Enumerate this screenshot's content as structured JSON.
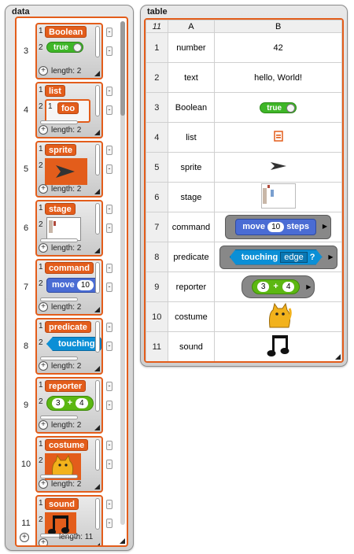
{
  "data_watcher": {
    "label": "data",
    "length_label": "length: 11",
    "items": [
      {
        "index": "3",
        "kind": "Boolean",
        "title": "Boolean",
        "value": "true",
        "length": "length: 2"
      },
      {
        "index": "4",
        "kind": "list",
        "title": "list",
        "value": "foo",
        "length": "length: 2"
      },
      {
        "index": "5",
        "kind": "sprite",
        "title": "sprite",
        "length": "length: 2"
      },
      {
        "index": "6",
        "kind": "stage",
        "title": "stage",
        "length": "length: 2"
      },
      {
        "index": "7",
        "kind": "command",
        "title": "command",
        "value": "move",
        "value2": "10",
        "length": "length: 2"
      },
      {
        "index": "8",
        "kind": "predicate",
        "title": "predicate",
        "value": "touching",
        "length": "length: 2"
      },
      {
        "index": "9",
        "kind": "reporter",
        "title": "reporter",
        "value": "3",
        "value2": "+",
        "value3": "4",
        "length": "length: 2"
      },
      {
        "index": "10",
        "kind": "costume",
        "title": "costume",
        "length": "length: 2"
      },
      {
        "index": "11",
        "kind": "sound",
        "title": "sound",
        "length": ""
      }
    ]
  },
  "table_watcher": {
    "label": "table",
    "corner": "11",
    "col_a": "A",
    "col_b": "B",
    "rows": [
      {
        "index": "1",
        "a": "number",
        "b": "42",
        "b_kind": "text"
      },
      {
        "index": "2",
        "a": "text",
        "b": "hello, World!",
        "b_kind": "text"
      },
      {
        "index": "3",
        "a": "Boolean",
        "b": "true",
        "b_kind": "boolean"
      },
      {
        "index": "4",
        "a": "list",
        "b": "",
        "b_kind": "list-icon"
      },
      {
        "index": "5",
        "a": "sprite",
        "b": "",
        "b_kind": "sprite-icon"
      },
      {
        "index": "6",
        "a": "stage",
        "b": "",
        "b_kind": "stage-thumb"
      },
      {
        "index": "7",
        "a": "command",
        "b": "move",
        "b2": "10",
        "b3": "steps",
        "b_kind": "command"
      },
      {
        "index": "8",
        "a": "predicate",
        "b": "touching",
        "b2": "edge",
        "b3": "?",
        "b_kind": "predicate"
      },
      {
        "index": "9",
        "a": "reporter",
        "b": "3",
        "b2": "+",
        "b3": "4",
        "b_kind": "reporter"
      },
      {
        "index": "10",
        "a": "costume",
        "b": "",
        "b_kind": "costume-icon"
      },
      {
        "index": "11",
        "a": "sound",
        "b": "",
        "b_kind": "sound-icon"
      }
    ]
  },
  "colors": {
    "list_orange": "#e35d1b",
    "boolean_green": "#3fb628",
    "motion_blue": "#4a6cd4",
    "sensing_blue": "#0b8fd6",
    "operator_green": "#5cb712"
  },
  "icons": {
    "sprite": "arrowhead-sprite-icon",
    "sound": "music-note-icon",
    "costume": "cat-costume-icon",
    "list": "list-icon"
  }
}
